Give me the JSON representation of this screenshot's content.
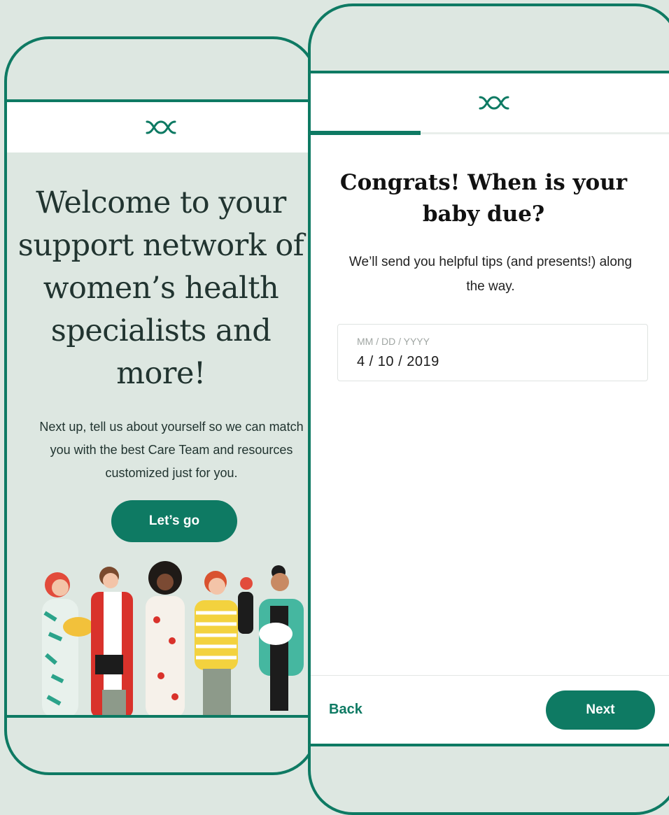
{
  "colors": {
    "brand_green": "#0e7a63",
    "mint_bg": "#dde7e1",
    "white": "#ffffff"
  },
  "welcome_screen": {
    "logo_icon": "brand-logo-icon",
    "title": "Welcome to your support network of women’s health specialists and more!",
    "subtitle": "Next up, tell us about yourself so we can match you with the best Care Team and resources customized just for you.",
    "cta_label": "Let’s go",
    "illustration": "women-group-illustration"
  },
  "due_date_screen": {
    "logo_icon": "brand-logo-icon",
    "progress_fraction": 0.3,
    "title": "Congrats! When is your baby due?",
    "subtitle": "We’ll send you helpful tips (and presents!) along the way.",
    "date_input": {
      "placeholder": "MM / DD / YYYY",
      "value": "4 / 10 / 2019"
    },
    "back_label": "Back",
    "next_label": "Next"
  }
}
